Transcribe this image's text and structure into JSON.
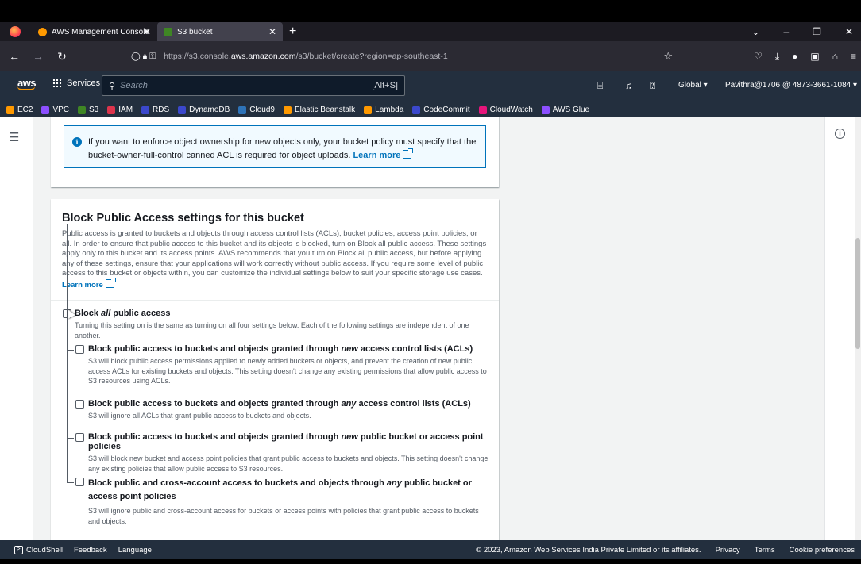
{
  "browser": {
    "tabs": [
      {
        "label": "AWS Management Console",
        "active": false
      },
      {
        "label": "S3 bucket",
        "active": true
      }
    ],
    "new_tab": "+",
    "url_prefix": "https://s3.console.",
    "url_host": "aws.amazon.com",
    "url_path": "/s3/bucket/create?region=ap-southeast-1"
  },
  "aws_nav": {
    "logo": "aws",
    "services_label": "Services",
    "search_placeholder": "Search",
    "search_shortcut": "[Alt+S]",
    "region": "Global ▾",
    "account": "Pavithra@1706 @ 4873-3661-1084 ▾"
  },
  "favorites": [
    {
      "label": "EC2",
      "color": "#ff9900"
    },
    {
      "label": "VPC",
      "color": "#8c4fff"
    },
    {
      "label": "S3",
      "color": "#3f8624"
    },
    {
      "label": "IAM",
      "color": "#dd344c"
    },
    {
      "label": "RDS",
      "color": "#3b48cc"
    },
    {
      "label": "DynamoDB",
      "color": "#3b48cc"
    },
    {
      "label": "Cloud9",
      "color": "#2e73b8"
    },
    {
      "label": "Elastic Beanstalk",
      "color": "#ff9900"
    },
    {
      "label": "Lambda",
      "color": "#ff9900"
    },
    {
      "label": "CodeCommit",
      "color": "#3b48cc"
    },
    {
      "label": "CloudWatch",
      "color": "#e7157b"
    },
    {
      "label": "AWS Glue",
      "color": "#8c4fff"
    }
  ],
  "info_box": {
    "text_1": "If you want to enforce object ownership for new objects only, your bucket policy must specify that the",
    "text_2": "bucket-owner-full-control canned ACL is required for object uploads.",
    "link": "Learn more"
  },
  "block_public_access": {
    "title": "Block Public Access settings for this bucket",
    "description": "Public access is granted to buckets and objects through access control lists (ACLs), bucket policies, access point policies, or all. In order to ensure that public access to this bucket and its objects is blocked, turn on Block all public access. These settings apply only to this bucket and its access points. AWS recommends that you turn on Block all public access, but before applying any of these settings, ensure that your applications will work correctly without public access. If you require some level of public access to this bucket or objects within, you can customize the individual settings below to suit your specific storage use cases.",
    "link": "Learn more",
    "block_all": {
      "title_pre": "Block ",
      "title_em": "all",
      "title_post": " public access",
      "desc": "Turning this setting on is the same as turning on all four settings below. Each of the following settings are independent of one another.",
      "checked": false
    },
    "options": [
      {
        "title_pre": "Block public access to buckets and objects granted through ",
        "title_em": "new",
        "title_post": " access control lists (ACLs)",
        "desc": "S3 will block public access permissions applied to newly added buckets or objects, and prevent the creation of new public access ACLs for existing buckets and objects. This setting doesn't change any existing permissions that allow public access to S3 resources using ACLs.",
        "checked": false
      },
      {
        "title_pre": "Block public access to buckets and objects granted through ",
        "title_em": "any",
        "title_post": " access control lists (ACLs)",
        "desc": "S3 will ignore all ACLs that grant public access to buckets and objects.",
        "checked": false
      },
      {
        "title_pre": "Block public access to buckets and objects granted through ",
        "title_em": "new",
        "title_post": " public bucket or access point policies",
        "desc": "S3 will block new bucket and access point policies that grant public access to buckets and objects. This setting doesn't change any existing policies that allow public access to S3 resources.",
        "checked": false
      },
      {
        "title_pre": "Block public and cross-account access to buckets and objects through ",
        "title_em": "any",
        "title_post": " public bucket or access point policies",
        "desc": "S3 will ignore public and cross-account access for buckets or access points with policies that grant public access to buckets and objects.",
        "checked": false
      }
    ]
  },
  "footer": {
    "cloudshell": "CloudShell",
    "feedback": "Feedback",
    "language": "Language",
    "copyright": "© 2023, Amazon Web Services India Private Limited or its affiliates.",
    "privacy": "Privacy",
    "terms": "Terms",
    "cookies": "Cookie preferences"
  }
}
